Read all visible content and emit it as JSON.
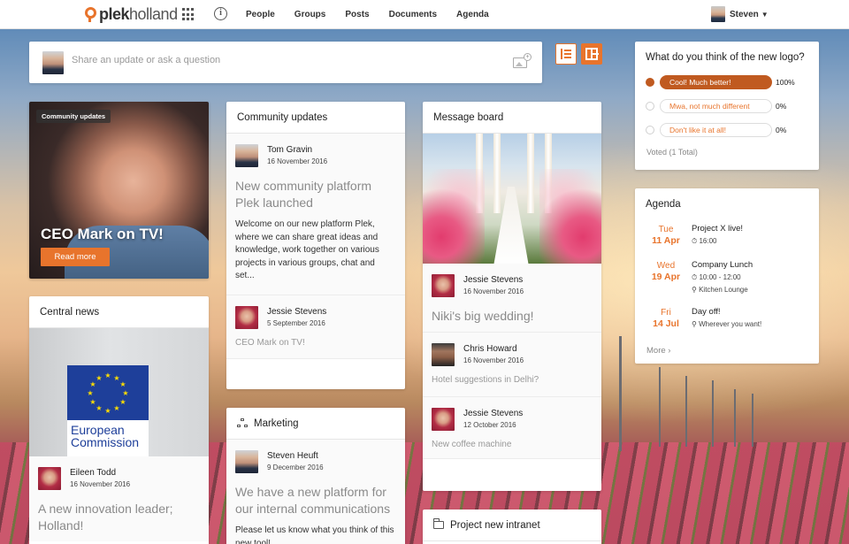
{
  "topbar": {
    "logo_prefix": "plek",
    "logo_suffix": "holland",
    "nav": [
      "People",
      "Groups",
      "Posts",
      "Documents",
      "Agenda"
    ],
    "user_name": "Steven"
  },
  "composer": {
    "placeholder": "Share an update or ask a question"
  },
  "hero": {
    "badge": "Community updates",
    "title": "CEO Mark on TV!",
    "button": "Read more"
  },
  "community_updates": {
    "title": "Community updates",
    "posts": [
      {
        "author": "Tom Gravin",
        "date": "16 November 2016",
        "title": "New community platform Plek launched",
        "body": "Welcome on our new platform Plek, where we can share great ideas and knowledge, work together on various projects in various groups, chat and set..."
      },
      {
        "author": "Jessie Stevens",
        "date": "5 September 2016",
        "title": "CEO Mark on TV!"
      }
    ]
  },
  "central_news": {
    "title": "Central news",
    "image_label_line1": "European",
    "image_label_line2": "Commission",
    "post": {
      "author": "Eileen Todd",
      "date": "16 November 2016",
      "title": "A new innovation leader; Holland!"
    }
  },
  "marketing": {
    "title": "Marketing",
    "post": {
      "author": "Steven Heuft",
      "date": "9 December 2016",
      "title": "We have a new platform for our internal communications",
      "body": "Please let us know what you think of this new tool!"
    }
  },
  "message_board": {
    "title": "Message board",
    "posts": [
      {
        "author": "Jessie Stevens",
        "date": "16 November 2016",
        "title": "Niki's big wedding!"
      },
      {
        "author": "Chris Howard",
        "date": "16 November 2016",
        "title": "Hotel suggestions in Delhi?"
      },
      {
        "author": "Jessie Stevens",
        "date": "12 October 2016",
        "title": "New coffee machine"
      }
    ]
  },
  "project_intranet": {
    "title": "Project new intranet"
  },
  "poll": {
    "question": "What do you think of the new logo?",
    "options": [
      {
        "label": "Cool! Much better!",
        "percent": "100%",
        "fraction": 1.0,
        "selected": true
      },
      {
        "label": "Mwa, not much different",
        "percent": "0%",
        "fraction": 0.0,
        "selected": false
      },
      {
        "label": "Don't like it at all!",
        "percent": "0%",
        "fraction": 0.0,
        "selected": false
      }
    ],
    "voted": "Voted (1 Total)"
  },
  "agenda": {
    "title": "Agenda",
    "items": [
      {
        "weekday": "Tue",
        "date": "11 Apr",
        "title": "Project X live!",
        "time": "16:00"
      },
      {
        "weekday": "Wed",
        "date": "19 Apr",
        "title": "Company Lunch",
        "time": "10:00 - 12:00",
        "location": "Kitchen Lounge"
      },
      {
        "weekday": "Fri",
        "date": "14 Jul",
        "title": "Day off!",
        "location": "Wherever you want!"
      }
    ],
    "more": "More"
  },
  "colors": {
    "accent": "#e8742c",
    "poll_fill": "#c05a20"
  }
}
